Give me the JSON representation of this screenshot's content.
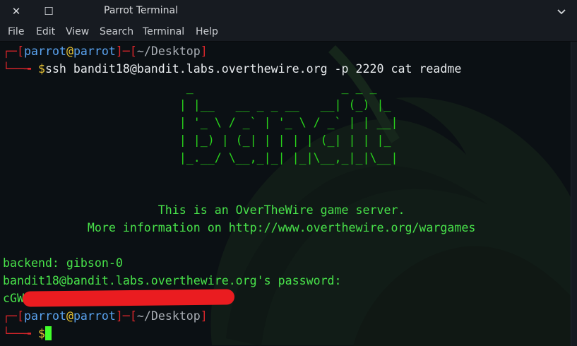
{
  "window": {
    "title": "Parrot Terminal",
    "close_glyph": "✕",
    "maximize_glyph": "☐"
  },
  "menu": [
    "File",
    "Edit",
    "View",
    "Search",
    "Terminal",
    "Help"
  ],
  "prompt1": {
    "open": "┌─[",
    "user": "parrot",
    "at": "@",
    "host": "parrot",
    "sep": "]─[",
    "path": "~/Desktop",
    "close": "]",
    "arrow": "└──╼ ",
    "dollar": "$",
    "command": "ssh bandit18@bandit.labs.overthewire.org -p 2220 cat readme"
  },
  "banner": [
    "                          _                     _ _ _",
    "                         | |__   __ _ _ __   __| (_) |_",
    "                         | '_ \\ / _` | '_ \\ / _` | | __|",
    "                         | |_) | (_| | | | | (_| | | |_",
    "                         |_.__/ \\__,_|_| |_|\\__,_|_|\\__|"
  ],
  "server_line": "                      This is an OverTheWire game server.",
  "info_line": "            More information on http://www.overthewire.org/wargames",
  "backend": "backend: gibson-0",
  "password_prompt": "bandit18@bandit.labs.overthewire.org's password:",
  "redacted_prefix": "cGW",
  "prompt2": {
    "open": "┌─[",
    "user": "parrot",
    "at": "@",
    "host": "parrot",
    "sep": "]─[",
    "path": "~/Desktop",
    "close": "]",
    "arrow": "└──╼ ",
    "dollar": "$"
  },
  "colors": {
    "prompt_red": "#d9262b",
    "user_blue": "#5aa3f0",
    "output_green": "#48e24a",
    "cursor_green": "#41ff2b"
  }
}
